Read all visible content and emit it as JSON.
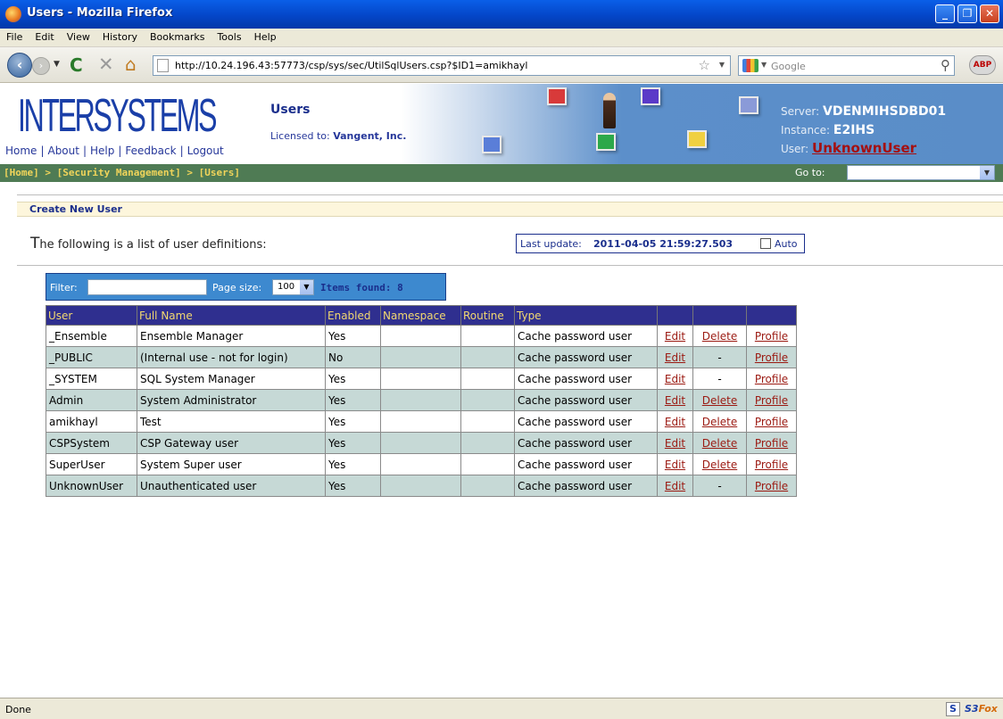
{
  "window": {
    "title": "Users - Mozilla Firefox",
    "controls": {
      "minimize": "_",
      "maximize": "❐",
      "close": "✕"
    }
  },
  "menu": [
    "File",
    "Edit",
    "View",
    "History",
    "Bookmarks",
    "Tools",
    "Help"
  ],
  "navbar": {
    "url": "http://10.24.196.43:57773/csp/sys/sec/UtilSqlUsers.csp?$ID1=amikhayl",
    "search_placeholder": "Google",
    "abp_label": "ABP"
  },
  "header": {
    "logo": "INTERSYSTEMS",
    "links": [
      "Home",
      "About",
      "Help",
      "Feedback",
      "Logout"
    ],
    "page_title": "Users",
    "license_label": "Licensed to:",
    "license_value": "Vangent, Inc.",
    "server_label": "Server:",
    "server_value": "VDENMIHSDBD01",
    "instance_label": "Instance:",
    "instance_value": "E2IHS",
    "user_label": "User:",
    "user_value": "UnknownUser"
  },
  "breadcrumb": [
    "[Home]",
    "[Security Management]",
    "[Users]"
  ],
  "goto_label": "Go to:",
  "create_link": "Create New User",
  "intro_first": "T",
  "intro_rest": "he following is a list of user definitions:",
  "last_update": {
    "label": "Last update:",
    "value": "2011-04-05 21:59:27.503",
    "auto_label": "Auto"
  },
  "filter": {
    "label": "Filter:",
    "value": "",
    "page_size_label": "Page size:",
    "page_size": "100",
    "items_found": "Items found: 8"
  },
  "table": {
    "columns": [
      "User",
      "Full Name",
      "Enabled",
      "Namespace",
      "Routine",
      "Type",
      "",
      "",
      ""
    ],
    "rows": [
      {
        "user": "_Ensemble",
        "full_name": "Ensemble Manager",
        "enabled": "Yes",
        "namespace": "",
        "routine": "",
        "type": "Cache password user",
        "edit": "Edit",
        "delete": "Delete",
        "profile": "Profile"
      },
      {
        "user": "_PUBLIC",
        "full_name": "(Internal use - not for login)",
        "enabled": "No",
        "namespace": "",
        "routine": "",
        "type": "Cache password user",
        "edit": "Edit",
        "delete": "-",
        "profile": "Profile"
      },
      {
        "user": "_SYSTEM",
        "full_name": "SQL System Manager",
        "enabled": "Yes",
        "namespace": "",
        "routine": "",
        "type": "Cache password user",
        "edit": "Edit",
        "delete": "-",
        "profile": "Profile"
      },
      {
        "user": "Admin",
        "full_name": "System Administrator",
        "enabled": "Yes",
        "namespace": "",
        "routine": "",
        "type": "Cache password user",
        "edit": "Edit",
        "delete": "Delete",
        "profile": "Profile"
      },
      {
        "user": "amikhayl",
        "full_name": "Test",
        "enabled": "Yes",
        "namespace": "",
        "routine": "",
        "type": "Cache password user",
        "edit": "Edit",
        "delete": "Delete",
        "profile": "Profile"
      },
      {
        "user": "CSPSystem",
        "full_name": "CSP Gateway user",
        "enabled": "Yes",
        "namespace": "",
        "routine": "",
        "type": "Cache password user",
        "edit": "Edit",
        "delete": "Delete",
        "profile": "Profile"
      },
      {
        "user": "SuperUser",
        "full_name": "System Super user",
        "enabled": "Yes",
        "namespace": "",
        "routine": "",
        "type": "Cache password user",
        "edit": "Edit",
        "delete": "Delete",
        "profile": "Profile"
      },
      {
        "user": "UnknownUser",
        "full_name": "Unauthenticated user",
        "enabled": "Yes",
        "namespace": "",
        "routine": "",
        "type": "Cache password user",
        "edit": "Edit",
        "delete": "-",
        "profile": "Profile"
      }
    ]
  },
  "status": {
    "text": "Done",
    "s3_icon": "S",
    "s3fox_a": "S3",
    "s3fox_b": "Fox"
  },
  "colors": {
    "header_blue": "#1a2e8c",
    "crumb_green": "#4f7b54",
    "crumb_yellow": "#f0d45a",
    "table_header": "#2f2f8f",
    "link_red": "#9b1a12"
  }
}
